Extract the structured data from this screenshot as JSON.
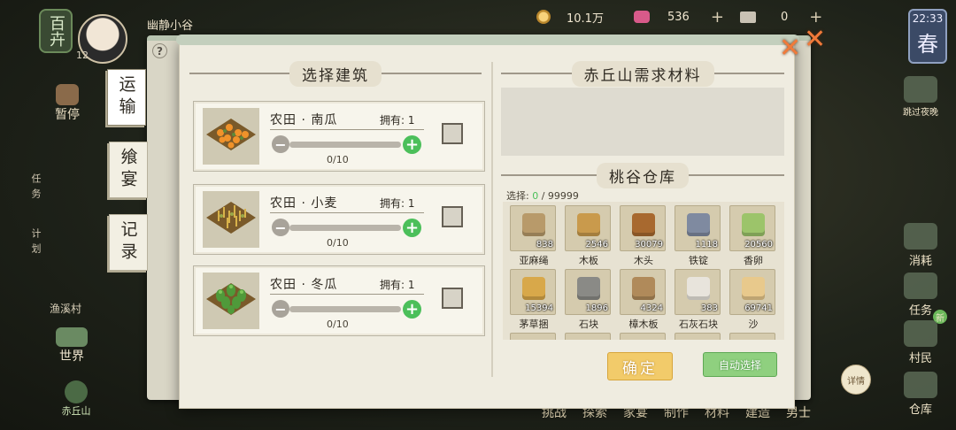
{
  "hud": {
    "season_badge": "百卉",
    "avatar_level": "12",
    "place_name": "幽静小谷",
    "coins": "10.1万",
    "gems": "536",
    "tickets": "0",
    "time": "22:33",
    "season": "春"
  },
  "left_sidebar": {
    "pause": "暂停",
    "task": "任务",
    "plan": "计划",
    "fishing": "渔溪村",
    "world": "世界",
    "home": "赤丘山"
  },
  "right_sidebar": {
    "skip_night": "跳过夜晚",
    "consume": "消耗",
    "quest": "任务",
    "villager": "村民",
    "warehouse": "仓库",
    "new_badge": "新"
  },
  "bottom_bar": [
    "挑战",
    "探索",
    "家宴",
    "制作",
    "材料",
    "建造",
    "男士"
  ],
  "detail_button": "详情",
  "dialog": {
    "tabs": [
      "运输",
      "飨宴",
      "记录"
    ],
    "left_title": "选择建筑",
    "right_title": "赤丘山需求材料",
    "warehouse_title": "桃谷仓库",
    "select_prefix": "选择:",
    "select_current": "0",
    "select_max": "/ 99999",
    "confirm": "确定",
    "auto_select": "自动选择",
    "buildings": [
      {
        "name": "农田 · 南瓜",
        "owned": "拥有: 1",
        "count": "0/10",
        "icon": "pumpkin-field-icon"
      },
      {
        "name": "农田 · 小麦",
        "owned": "拥有: 1",
        "count": "0/10",
        "icon": "wheat-field-icon"
      },
      {
        "name": "农田 · 冬瓜",
        "owned": "拥有: 1",
        "count": "0/10",
        "icon": "wintermelon-field-icon"
      }
    ],
    "materials": [
      {
        "name": "亚麻绳",
        "qty": "838",
        "color": "#b89a6a"
      },
      {
        "name": "木板",
        "qty": "2546",
        "color": "#c99a4c"
      },
      {
        "name": "木头",
        "qty": "30079",
        "color": "#a8692f"
      },
      {
        "name": "铁锭",
        "qty": "1118",
        "color": "#7f8aa0"
      },
      {
        "name": "香卵",
        "qty": "20560",
        "color": "#9cc46a"
      },
      {
        "name": "茅草捆",
        "qty": "15394",
        "color": "#d8a84a"
      },
      {
        "name": "石块",
        "qty": "1896",
        "color": "#8a8a86"
      },
      {
        "name": "樟木板",
        "qty": "4324",
        "color": "#b08a5a"
      },
      {
        "name": "石灰石块",
        "qty": "383",
        "color": "#e8e4dc"
      },
      {
        "name": "沙",
        "qty": "69741",
        "color": "#e8c98c"
      }
    ]
  }
}
